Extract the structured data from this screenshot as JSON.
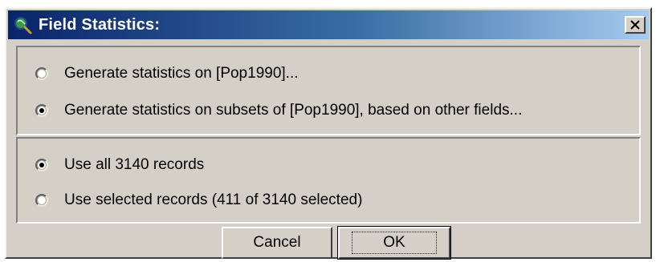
{
  "window": {
    "title": "Field Statistics:",
    "app_icon": "magnifier-globe-icon",
    "close_icon": "close-x-icon"
  },
  "statistics_group": {
    "options": [
      {
        "label": "Generate statistics on [Pop1990]...",
        "checked": false
      },
      {
        "label": "Generate statistics on subsets of [Pop1990], based on other fields...",
        "checked": true
      }
    ]
  },
  "records_group": {
    "options": [
      {
        "label": "Use all 3140 records",
        "checked": true
      },
      {
        "label": "Use selected records (411 of 3140 selected)",
        "checked": false
      }
    ]
  },
  "buttons": {
    "cancel": "Cancel",
    "ok": "OK"
  },
  "colors": {
    "title_start": "#0a246a",
    "title_end": "#a6caf0",
    "face": "#d4d0c8"
  }
}
